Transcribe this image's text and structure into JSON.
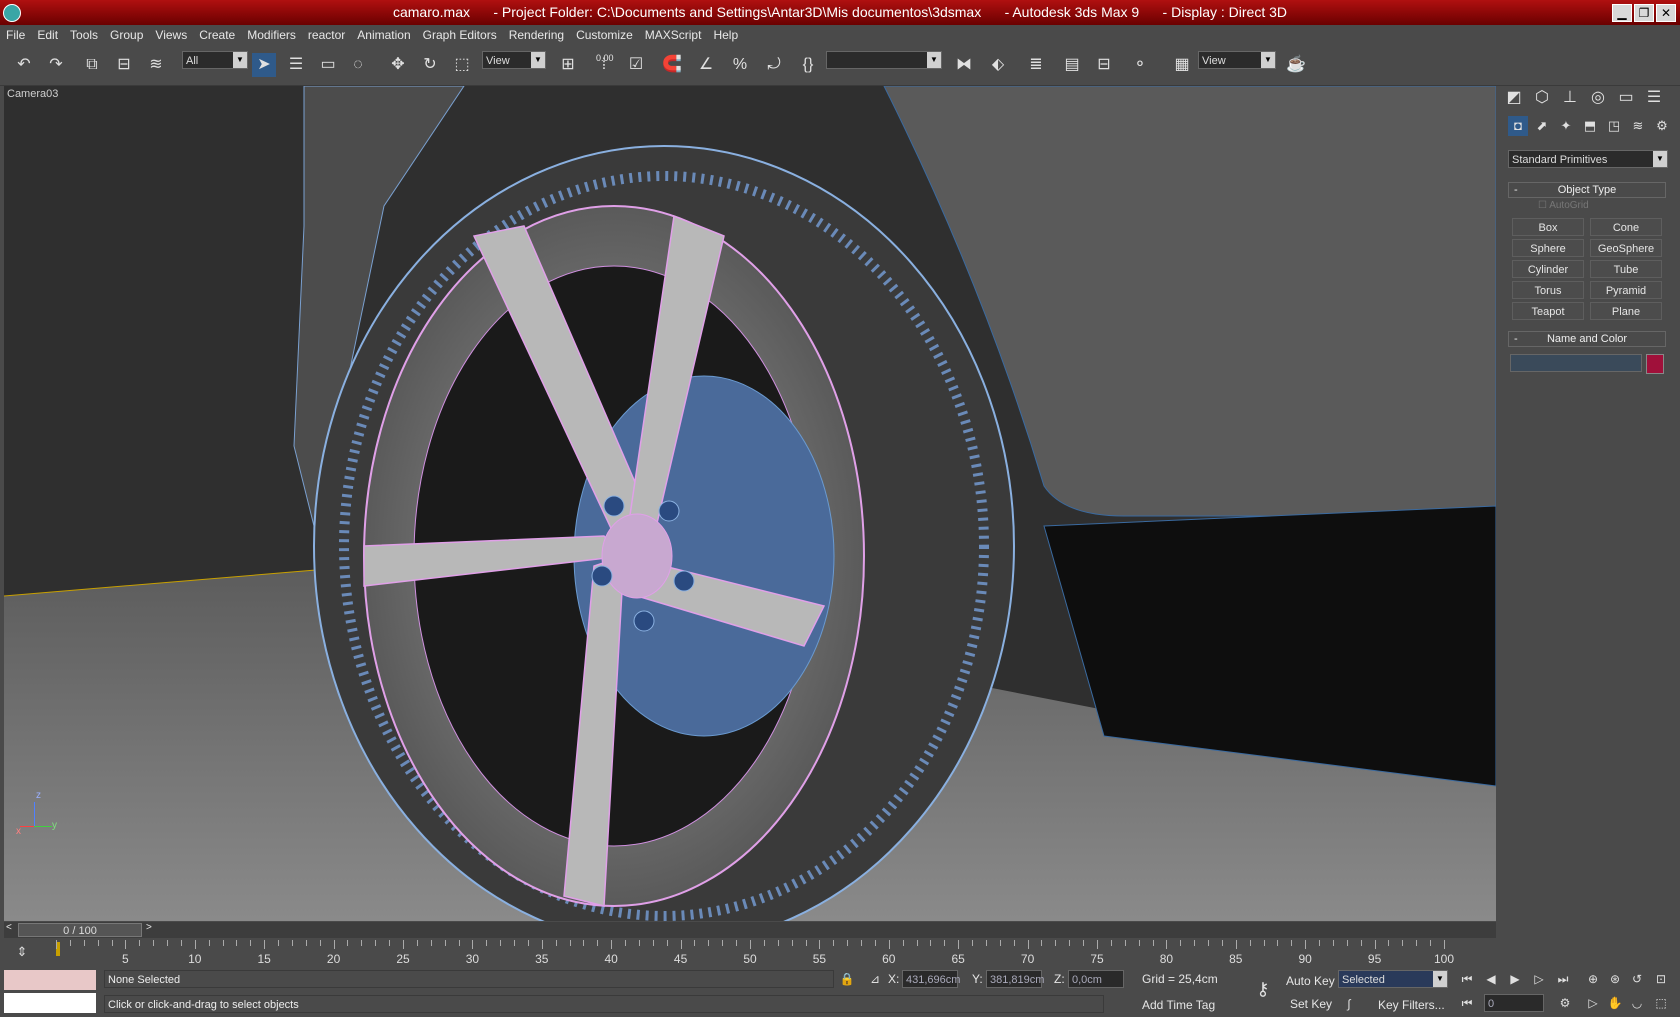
{
  "title": {
    "file": "camaro.max",
    "project": "- Project Folder: C:\\Documents and Settings\\Antar3D\\Mis documentos\\3dsmax",
    "app": "- Autodesk 3ds Max 9",
    "display": "- Display : Direct 3D"
  },
  "menu": [
    "File",
    "Edit",
    "Tools",
    "Group",
    "Views",
    "Create",
    "Modifiers",
    "reactor",
    "Animation",
    "Graph Editors",
    "Rendering",
    "Customize",
    "MAXScript",
    "Help"
  ],
  "toolbar": {
    "selection_filter": "All",
    "ref_coord": "View",
    "named_selection": "",
    "view_dropdown": "View",
    "spinner_snap": "0.00"
  },
  "viewport": {
    "label": "Camera03"
  },
  "axis": {
    "z": "z",
    "x": "x",
    "y": "y"
  },
  "cmd_panel": {
    "category": "Standard Primitives",
    "object_type_title": "Object Type",
    "autogrid": "AutoGrid",
    "buttons": [
      "Box",
      "Cone",
      "Sphere",
      "GeoSphere",
      "Cylinder",
      "Tube",
      "Torus",
      "Pyramid",
      "Teapot",
      "Plane"
    ],
    "name_color_title": "Name and Color",
    "name_value": "",
    "color": "#a0103a"
  },
  "time": {
    "slider": "0 / 100",
    "ticks": [
      "5",
      "10",
      "15",
      "20",
      "25",
      "30",
      "35",
      "40",
      "45",
      "50",
      "55",
      "60",
      "65",
      "70",
      "75",
      "80",
      "85",
      "90",
      "95",
      "100"
    ]
  },
  "status": {
    "selection": "None Selected",
    "prompt": "Click or click-and-drag to select objects",
    "x_label": "X:",
    "x_value": "431,696cm",
    "y_label": "Y:",
    "y_value": "381,819cm",
    "z_label": "Z:",
    "z_value": "0,0cm",
    "grid": "Grid = 25,4cm",
    "add_time_tag": "Add Time Tag",
    "auto_key": "Auto Key",
    "set_key": "Set Key",
    "key_mode": "Selected",
    "key_filters": "Key Filters...",
    "frame": "0"
  }
}
